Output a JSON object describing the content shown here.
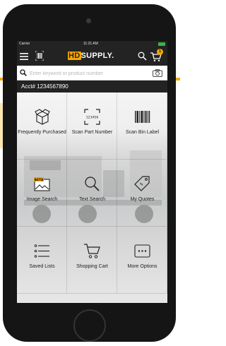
{
  "colors": {
    "brand_yellow": "#f5a800",
    "bar_dark": "#232323",
    "battery_green": "#38b449"
  },
  "status_bar": {
    "carrier": "Carrier",
    "time": "11:21 AM"
  },
  "app_bar": {
    "brand_hd": "HD",
    "brand_supply": "SUPPLY.",
    "cart_count": "1"
  },
  "search": {
    "placeholder": "Enter keyword or product number"
  },
  "account": {
    "label": "Acct# 1234567890"
  },
  "tiles": [
    {
      "label": "Frequently Purchased",
      "icon": "box-icon"
    },
    {
      "label": "Scan Part Number",
      "icon": "scan-part-icon",
      "icon_text": "123456"
    },
    {
      "label": "Scan Bin Label",
      "icon": "barcode-icon"
    },
    {
      "label": "Image Search",
      "icon": "image-icon",
      "badge": "BETA"
    },
    {
      "label": "Text Search",
      "icon": "search-icon"
    },
    {
      "label": "My Quotes",
      "icon": "tag-icon"
    },
    {
      "label": "Saved Lists",
      "icon": "list-icon"
    },
    {
      "label": "Shopping Cart",
      "icon": "cart-icon"
    },
    {
      "label": "More Options",
      "icon": "more-icon"
    }
  ]
}
